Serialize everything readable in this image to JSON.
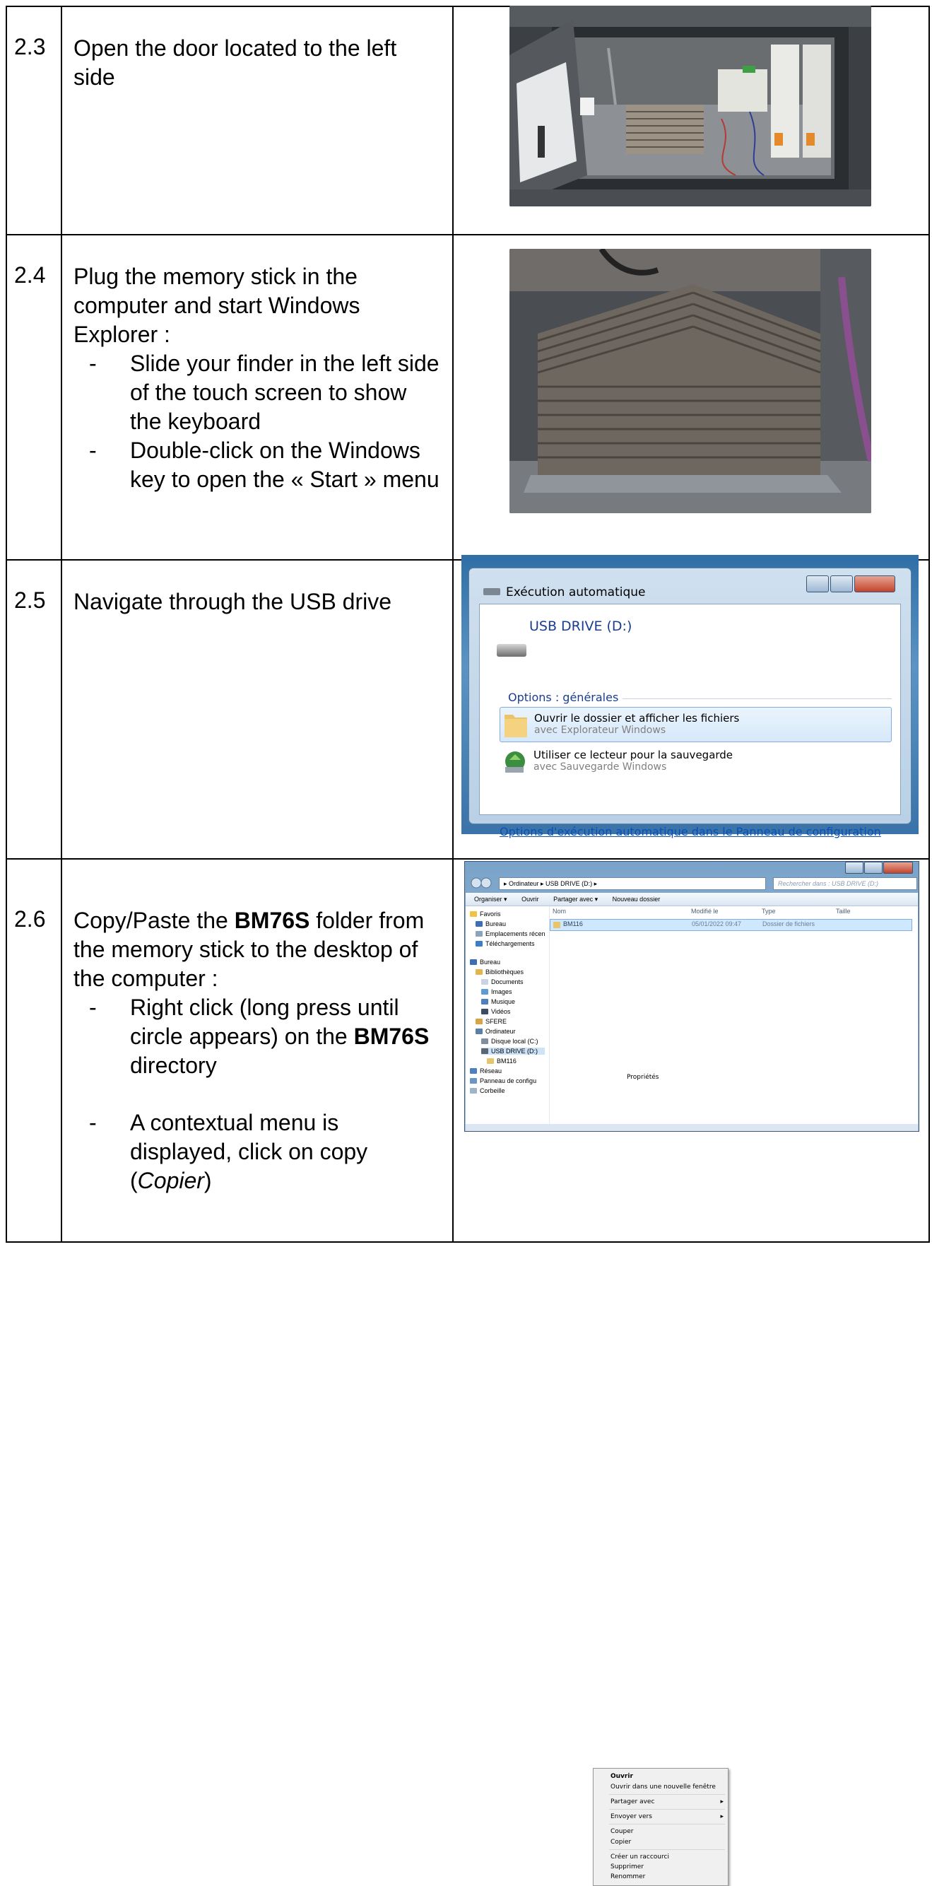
{
  "steps": [
    {
      "number": "2.3",
      "text": "Open the door located to the left side"
    },
    {
      "number": "2.4",
      "intro": "Plug the memory stick in the computer and start Windows Explorer :",
      "bullets": [
        "Slide your finder in the left side of the touch screen to show the keyboard",
        "Double-click on the Windows key to open the « Start » menu"
      ]
    },
    {
      "number": "2.5",
      "text": "Navigate through the USB drive"
    },
    {
      "number": "2.6",
      "intro_before": "Copy/Paste the ",
      "intro_bold": "BM76S",
      "intro_after": " folder from the memory stick to the desktop of the computer :",
      "bullet1_before": "Right click (long press until circle appears) on the ",
      "bullet1_bold": "BM76S",
      "bullet1_after": " directory",
      "bullet2_before": "A contextual menu is displayed, click on copy (",
      "bullet2_italic": "Copier",
      "bullet2_after": ")"
    }
  ],
  "autoplay": {
    "title": "Exécution automatique",
    "drive": "USB DRIVE (D:)",
    "options_header": "Options : générales",
    "option1_main": "Ouvrir le dossier et afficher les fichiers",
    "option1_sub": "avec Explorateur Windows",
    "option2_main": "Utiliser ce lecteur pour la sauvegarde",
    "option2_sub": "avec Sauvegarde Windows",
    "config_link": "Options d'exécution automatique dans le Panneau de configuration"
  },
  "explorer": {
    "address": "▸ Ordinateur ▸ USB DRIVE (D:) ▸",
    "search_placeholder": "Rechercher dans : USB DRIVE (D:)",
    "toolbar": [
      "Organiser ▾",
      "Ouvrir",
      "Partager avec ▾",
      "Nouveau dossier"
    ],
    "columns": [
      "Nom",
      "Modifié le",
      "Type",
      "Taille"
    ],
    "file": {
      "name": "BM116",
      "date": "05/01/2022 09:47",
      "type": "Dossier de fichiers"
    },
    "tree": [
      "Favoris",
      "Bureau",
      "Emplacements récen",
      "Téléchargements",
      "Bureau",
      "Bibliothèques",
      "Documents",
      "Images",
      "Musique",
      "Vidéos",
      "SFERE",
      "Ordinateur",
      "Disque local (C:)",
      "USB DRIVE (D:)",
      "BM116",
      "Réseau",
      "Panneau de configu",
      "Corbeille"
    ],
    "context_menu": [
      "Ouvrir",
      "Ouvrir dans une nouvelle fenêtre",
      "Partager avec",
      "Envoyer vers",
      "Couper",
      "Copier",
      "Créer un raccourci",
      "Supprimer",
      "Renommer",
      "Propriétés"
    ]
  }
}
